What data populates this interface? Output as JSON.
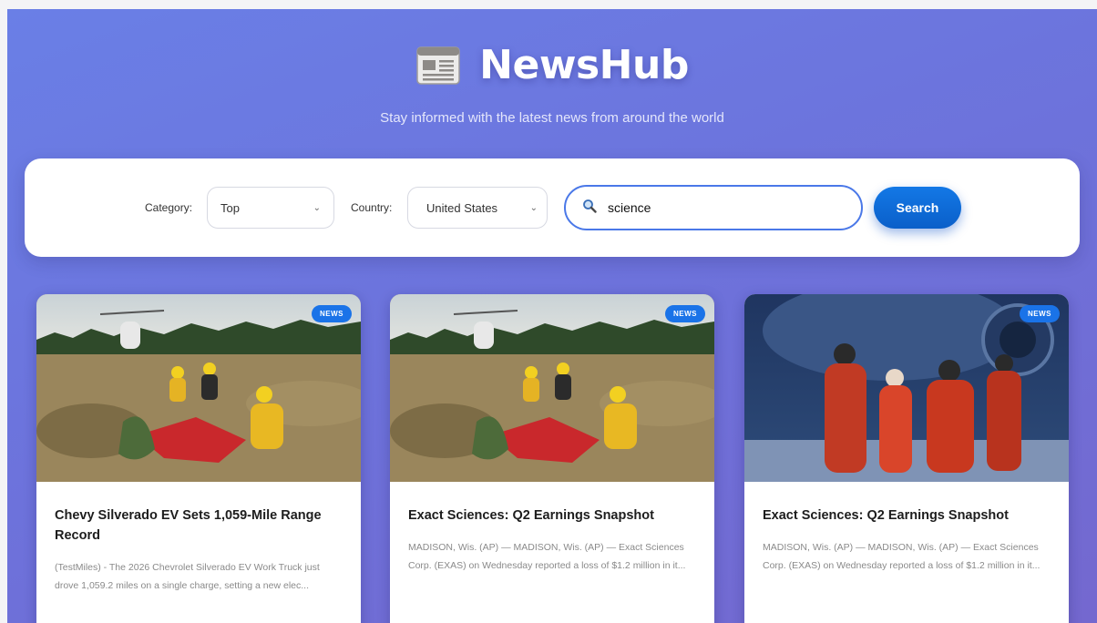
{
  "header": {
    "icon": "newspaper-icon",
    "title": "NewsHub",
    "tagline": "Stay informed with the latest news from around the world"
  },
  "filters": {
    "category_label": "Category:",
    "category_value": "Top",
    "country_label": "Country:",
    "country_value": "United States",
    "search_value": "science",
    "search_button": "Search"
  },
  "articles": [
    {
      "badge": "NEWS",
      "title": "Chevy Silverado EV Sets 1,059-Mile Range Record",
      "description": "(TestMiles) - The 2026 Chevrolet Silverado EV Work Truck just drove 1,059.2 miles on a single charge, setting a new elec..."
    },
    {
      "badge": "NEWS",
      "title": "Exact Sciences: Q2 Earnings Snapshot",
      "description": "MADISON, Wis. (AP) — MADISON, Wis. (AP) — Exact Sciences Corp. (EXAS) on Wednesday reported a loss of $1.2 million in it..."
    },
    {
      "badge": "NEWS",
      "title": "Exact Sciences: Q2 Earnings Snapshot",
      "description": "MADISON, Wis. (AP) — MADISON, Wis. (AP) — Exact Sciences Corp. (EXAS) on Wednesday reported a loss of $1.2 million in it..."
    }
  ],
  "colors": {
    "accent": "#1a73e8",
    "background_gradient_start": "#6a7fe6",
    "background_gradient_end": "#7468cf"
  }
}
